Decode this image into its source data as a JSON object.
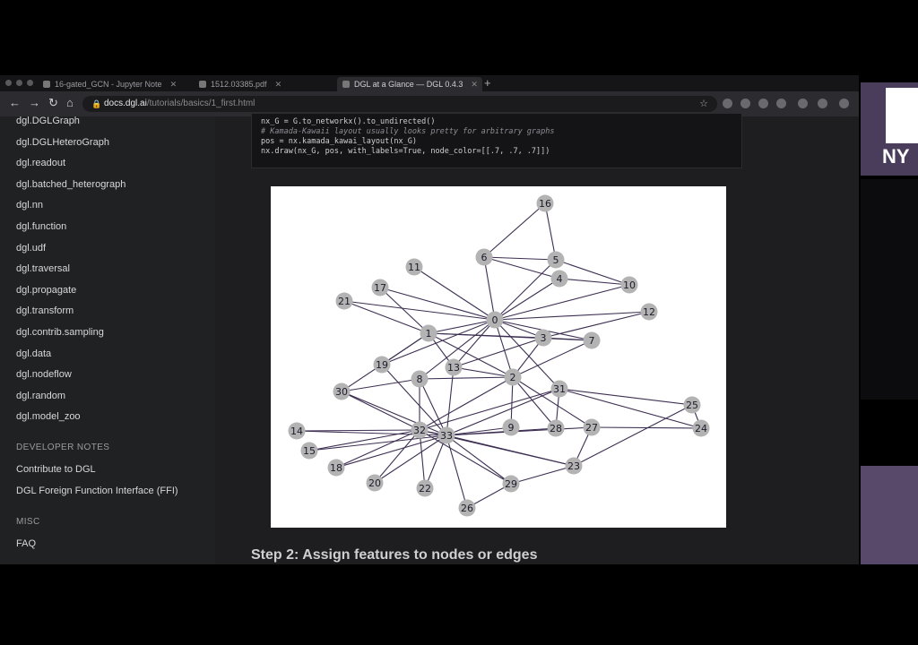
{
  "browser": {
    "tabs": [
      {
        "label": "16-gated_GCN - Jupyter Note"
      },
      {
        "label": "1512.03385.pdf"
      },
      {
        "label": "DGL at a Glance — DGL 0.4.3"
      }
    ],
    "url_host": "docs.dgl.ai",
    "url_path": "/tutorials/basics/1_first.html",
    "new_tab": "+"
  },
  "sidebar": {
    "items": [
      {
        "label": "dgl.DGLGraph"
      },
      {
        "label": "dgl.DGLHeteroGraph"
      },
      {
        "label": "dgl.readout"
      },
      {
        "label": "dgl.batched_heterograph"
      },
      {
        "label": "dgl.nn"
      },
      {
        "label": "dgl.function"
      },
      {
        "label": "dgl.udf"
      },
      {
        "label": "dgl.traversal"
      },
      {
        "label": "dgl.propagate"
      },
      {
        "label": "dgl.transform"
      },
      {
        "label": "dgl.contrib.sampling"
      },
      {
        "label": "dgl.data"
      },
      {
        "label": "dgl.nodeflow"
      },
      {
        "label": "dgl.random"
      },
      {
        "label": "dgl.model_zoo"
      }
    ],
    "developer_heading": "DEVELOPER NOTES",
    "developer_items": [
      {
        "label": "Contribute to DGL"
      },
      {
        "label": "DGL Foreign Function Interface (FFI)"
      }
    ],
    "misc_heading": "MISC",
    "misc_items": [
      {
        "label": "FAQ"
      }
    ]
  },
  "code": {
    "lines": [
      {
        "text": "nx_G = G.to_networkx().to_undirected()",
        "comment": false
      },
      {
        "text": "# Kamada-Kawaii layout usually looks pretty for arbitrary graphs",
        "comment": true
      },
      {
        "text": "pos = nx.kamada_kawai_layout(nx_G)",
        "comment": false
      },
      {
        "text": "nx.draw(nx_G, pos, with_labels=True, node_color=[[.7, .7, .7]])",
        "comment": false
      }
    ]
  },
  "graph": {
    "node_color": "#b3b3b3",
    "edge_color": "#3d2f52",
    "nodes": [
      "0",
      "1",
      "2",
      "3",
      "4",
      "5",
      "6",
      "7",
      "8",
      "9",
      "10",
      "11",
      "12",
      "13",
      "14",
      "15",
      "16",
      "17",
      "18",
      "19",
      "20",
      "21",
      "22",
      "23",
      "24",
      "25",
      "26",
      "27",
      "28",
      "29",
      "30",
      "31",
      "32",
      "33"
    ],
    "edges": [
      [
        "0",
        "1"
      ],
      [
        "0",
        "2"
      ],
      [
        "0",
        "3"
      ],
      [
        "0",
        "4"
      ],
      [
        "0",
        "5"
      ],
      [
        "0",
        "6"
      ],
      [
        "0",
        "7"
      ],
      [
        "0",
        "8"
      ],
      [
        "0",
        "10"
      ],
      [
        "0",
        "11"
      ],
      [
        "0",
        "12"
      ],
      [
        "0",
        "13"
      ],
      [
        "0",
        "17"
      ],
      [
        "0",
        "19"
      ],
      [
        "0",
        "21"
      ],
      [
        "0",
        "31"
      ],
      [
        "1",
        "2"
      ],
      [
        "1",
        "3"
      ],
      [
        "1",
        "7"
      ],
      [
        "1",
        "13"
      ],
      [
        "1",
        "17"
      ],
      [
        "1",
        "19"
      ],
      [
        "1",
        "21"
      ],
      [
        "1",
        "30"
      ],
      [
        "2",
        "3"
      ],
      [
        "2",
        "7"
      ],
      [
        "2",
        "8"
      ],
      [
        "2",
        "9"
      ],
      [
        "2",
        "13"
      ],
      [
        "2",
        "27"
      ],
      [
        "2",
        "28"
      ],
      [
        "2",
        "32"
      ],
      [
        "3",
        "7"
      ],
      [
        "3",
        "12"
      ],
      [
        "3",
        "13"
      ],
      [
        "4",
        "6"
      ],
      [
        "4",
        "10"
      ],
      [
        "5",
        "6"
      ],
      [
        "5",
        "10"
      ],
      [
        "5",
        "16"
      ],
      [
        "6",
        "16"
      ],
      [
        "8",
        "30"
      ],
      [
        "8",
        "32"
      ],
      [
        "8",
        "33"
      ],
      [
        "9",
        "33"
      ],
      [
        "13",
        "33"
      ],
      [
        "14",
        "32"
      ],
      [
        "14",
        "33"
      ],
      [
        "15",
        "32"
      ],
      [
        "15",
        "33"
      ],
      [
        "18",
        "32"
      ],
      [
        "18",
        "33"
      ],
      [
        "19",
        "33"
      ],
      [
        "20",
        "32"
      ],
      [
        "20",
        "33"
      ],
      [
        "22",
        "32"
      ],
      [
        "22",
        "33"
      ],
      [
        "23",
        "25"
      ],
      [
        "23",
        "27"
      ],
      [
        "23",
        "29"
      ],
      [
        "23",
        "32"
      ],
      [
        "23",
        "33"
      ],
      [
        "24",
        "25"
      ],
      [
        "24",
        "27"
      ],
      [
        "24",
        "31"
      ],
      [
        "25",
        "31"
      ],
      [
        "26",
        "29"
      ],
      [
        "26",
        "33"
      ],
      [
        "27",
        "33"
      ],
      [
        "28",
        "31"
      ],
      [
        "28",
        "33"
      ],
      [
        "29",
        "32"
      ],
      [
        "29",
        "33"
      ],
      [
        "30",
        "32"
      ],
      [
        "30",
        "33"
      ],
      [
        "31",
        "32"
      ],
      [
        "31",
        "33"
      ],
      [
        "32",
        "33"
      ]
    ]
  },
  "step_heading": "Step 2: Assign features to nodes or edges",
  "nyu": {
    "text": "NY"
  }
}
